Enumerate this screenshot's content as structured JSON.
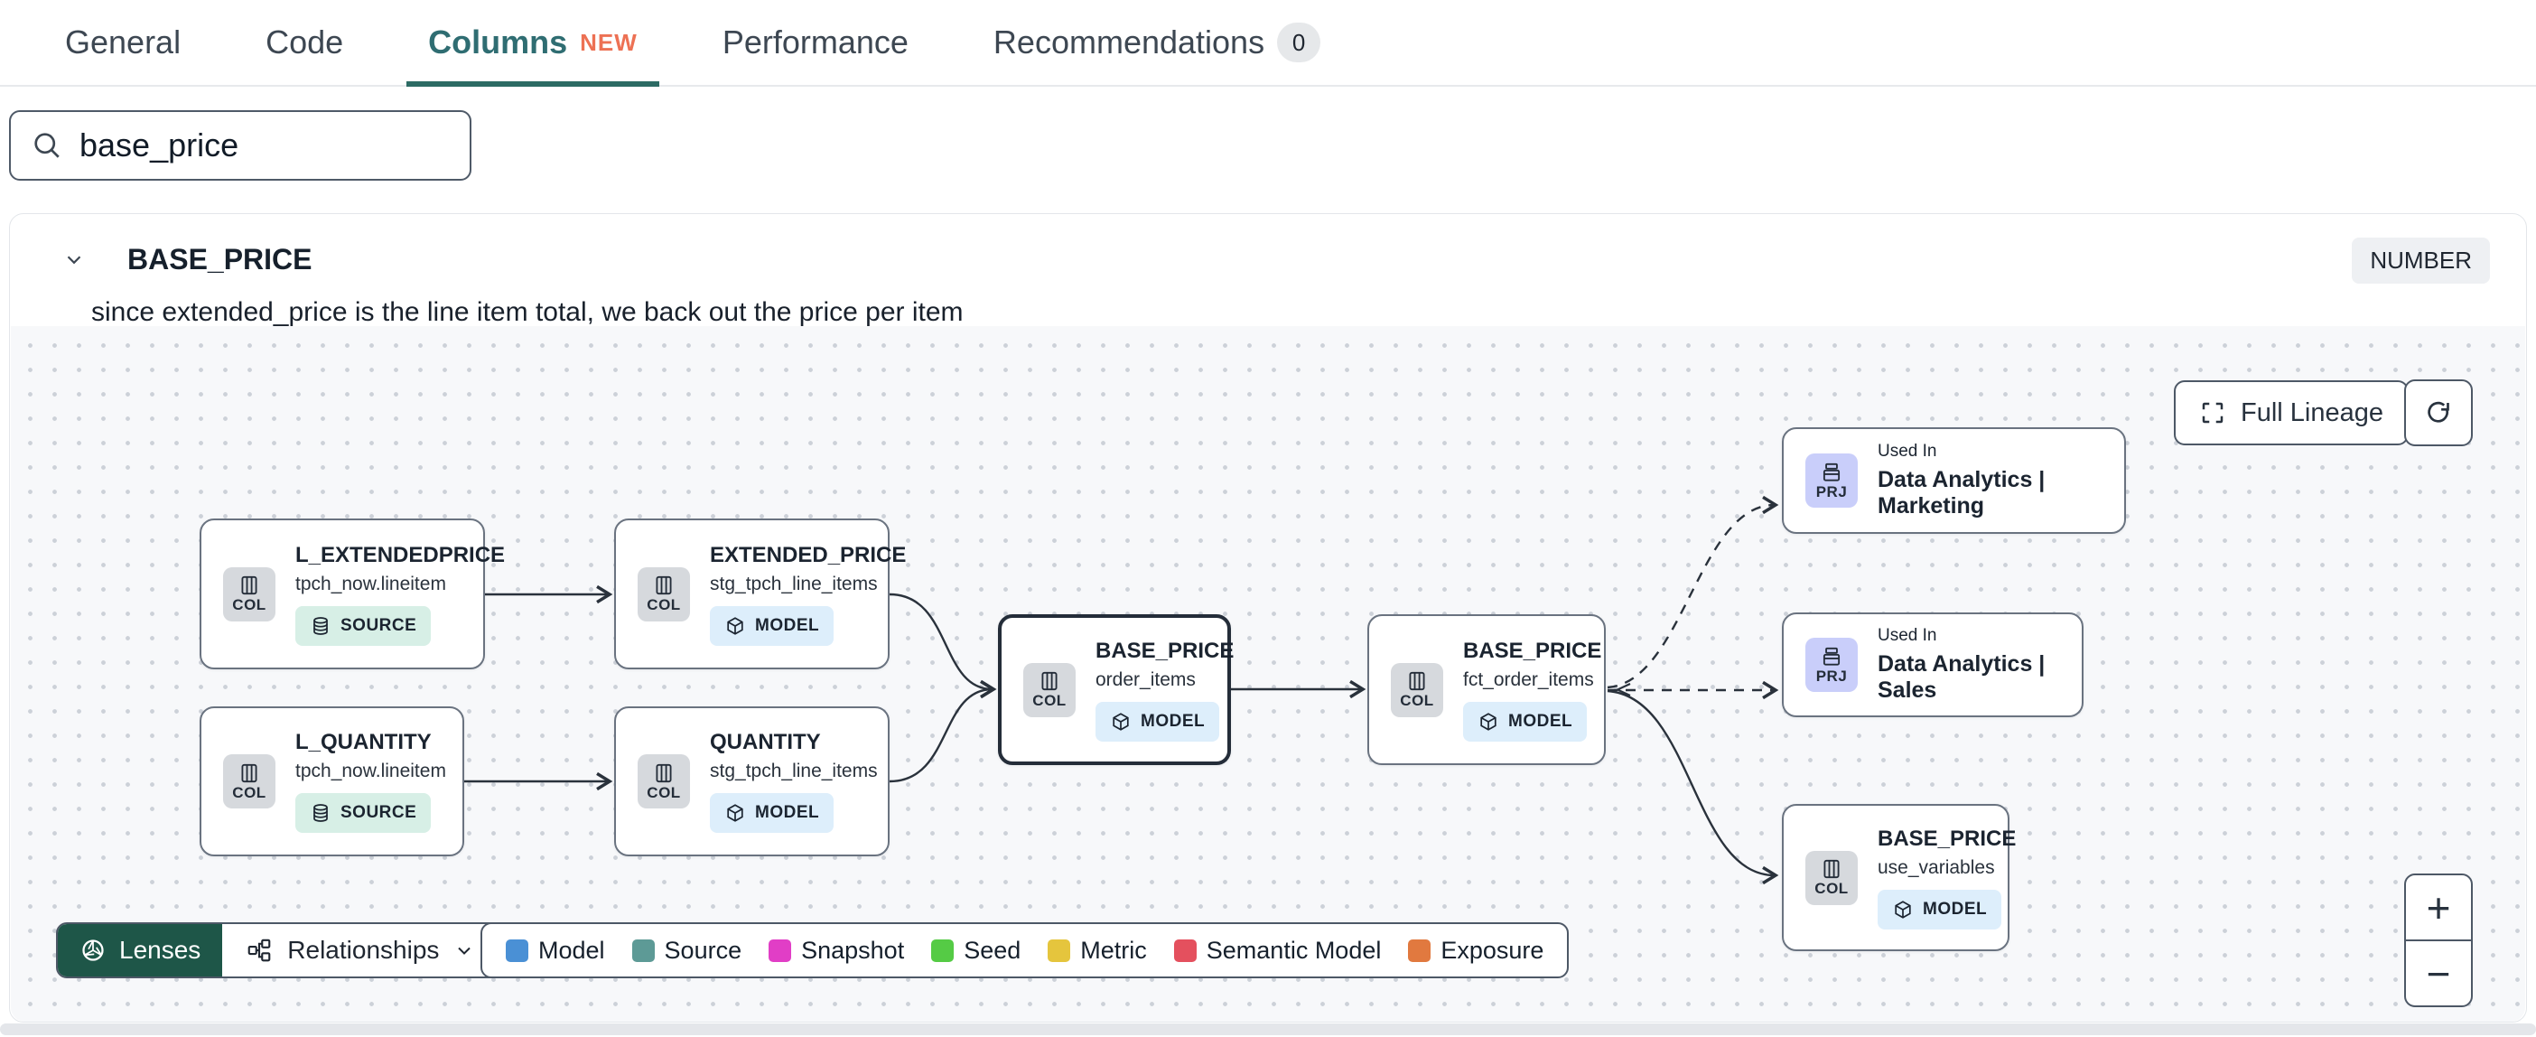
{
  "colors": {
    "accent_teal": "#2f6d72",
    "tab_underline": "#2c6b64",
    "new_badge_orange": "#ed7154",
    "lenses_green": "#1e5648",
    "node_border": "#6a7380",
    "selected_node_border": "#242d39",
    "col_badge_bg": "#d6d9dd",
    "prj_badge_bg": "#c9cefa",
    "model_badge_bg": "#ddeefb",
    "source_badge_bg": "#d7efe6",
    "canvas_bg": "#f7f8fa"
  },
  "tabs": {
    "items": [
      {
        "label": "General"
      },
      {
        "label": "Code"
      },
      {
        "label": "Columns",
        "badge": "NEW"
      },
      {
        "label": "Performance"
      },
      {
        "label": "Recommendations",
        "count": "0"
      }
    ]
  },
  "search": {
    "value": "base_price"
  },
  "column_panel": {
    "title": "BASE_PRICE",
    "type": "NUMBER",
    "description": "since extended_price is the line item total, we back out the price per item"
  },
  "lineage": {
    "full_lineage_button": "Full Lineage",
    "nodes": [
      {
        "badge": "COL",
        "title": "L_EXTENDEDPRICE",
        "subtitle": "tpch_now.lineitem",
        "resource_type": "SOURCE"
      },
      {
        "badge": "COL",
        "title": "EXTENDED_PRICE",
        "subtitle": "stg_tpch_line_items",
        "resource_type": "MODEL"
      },
      {
        "badge": "COL",
        "title": "L_QUANTITY",
        "subtitle": "tpch_now.lineitem",
        "resource_type": "SOURCE"
      },
      {
        "badge": "COL",
        "title": "QUANTITY",
        "subtitle": "stg_tpch_line_items",
        "resource_type": "MODEL"
      },
      {
        "badge": "COL",
        "title": "BASE_PRICE",
        "subtitle": "order_items",
        "resource_type": "MODEL",
        "selected": true
      },
      {
        "badge": "COL",
        "title": "BASE_PRICE",
        "subtitle": "fct_order_items",
        "resource_type": "MODEL"
      },
      {
        "badge": "PRJ",
        "kicker": "Used In",
        "title": "Data Analytics | Marketing"
      },
      {
        "badge": "PRJ",
        "kicker": "Used In",
        "title": "Data Analytics | Sales"
      },
      {
        "badge": "COL",
        "title": "BASE_PRICE",
        "subtitle": "use_variables",
        "resource_type": "MODEL"
      }
    ],
    "toolbar": {
      "lenses": "Lenses",
      "relationships": "Relationships"
    },
    "zoom_controls": {
      "zoom_in": "+",
      "zoom_out": "−"
    }
  },
  "legend": {
    "items": [
      {
        "label": "Model",
        "color": "#4a90d5"
      },
      {
        "label": "Source",
        "color": "#5d9a96"
      },
      {
        "label": "Snapshot",
        "color": "#e13ec6"
      },
      {
        "label": "Seed",
        "color": "#55cb45"
      },
      {
        "label": "Metric",
        "color": "#e5c53d"
      },
      {
        "label": "Semantic Model",
        "color": "#e4505e"
      },
      {
        "label": "Exposure",
        "color": "#e1793f"
      }
    ]
  }
}
